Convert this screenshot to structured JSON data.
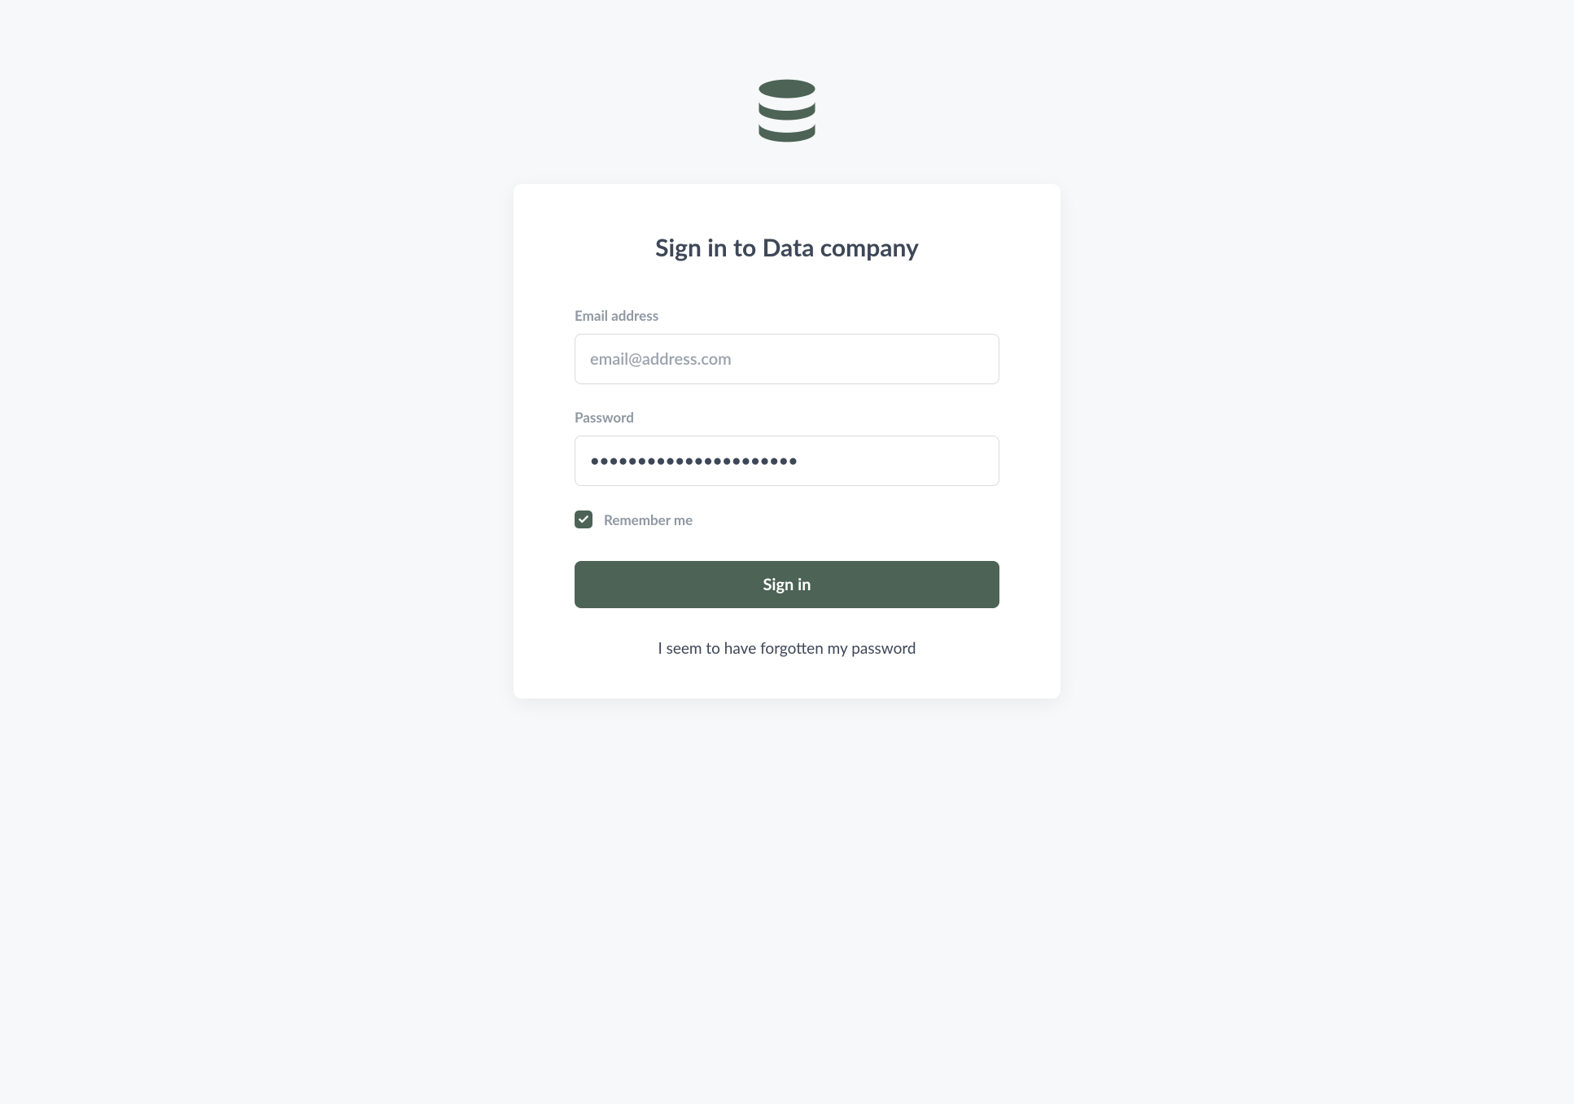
{
  "brand": {
    "icon": "database-icon",
    "color": "#4c6355"
  },
  "login": {
    "title": "Sign in to Data company",
    "email_label": "Email address",
    "email_placeholder": "email@address.com",
    "email_value": "",
    "password_label": "Password",
    "password_value": "aaaaaaaaaaaaaaaaaaaaaa",
    "remember_label": "Remember me",
    "remember_checked": true,
    "submit_label": "Sign in",
    "forgot_label": "I seem to have forgotten my password"
  }
}
